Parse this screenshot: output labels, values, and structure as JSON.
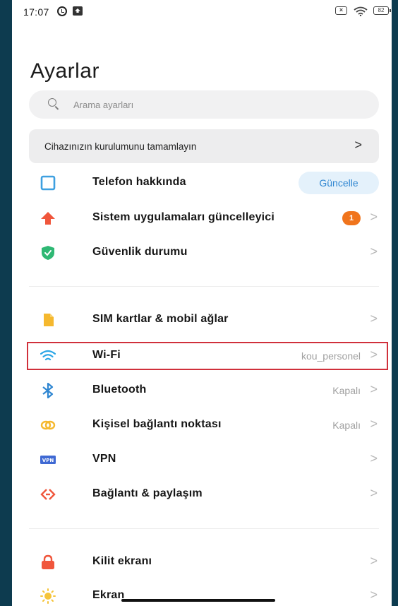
{
  "status_bar": {
    "time": "17:07",
    "alarm_icon": "alarm-clock-icon",
    "notification_icon": "upload-notification-icon",
    "sim_icon": "no-sim-icon",
    "wifi_icon": "wifi-icon",
    "battery_level": "82"
  },
  "page": {
    "title": "Ayarlar"
  },
  "search": {
    "placeholder": "Arama ayarları"
  },
  "setup_banner": {
    "text": "Cihazınızın kurulumunu tamamlayın",
    "chevron": ">"
  },
  "group1": [
    {
      "label": "Telefon hakkında",
      "action": "Güncelle",
      "icon": "phone-info-icon",
      "icon_color": "#3ea0e0"
    },
    {
      "label": "Sistem uygulamaları güncelleyici",
      "badge": "1",
      "chevron": ">",
      "icon": "arrow-up-icon",
      "icon_color": "#f0563c"
    },
    {
      "label": "Güvenlik durumu",
      "chevron": ">",
      "icon": "shield-check-icon",
      "icon_color": "#2fb874"
    }
  ],
  "group2": [
    {
      "label": "SIM kartlar & mobil ağlar",
      "chevron": ">",
      "icon": "sim-card-icon",
      "icon_color": "#f5b82e"
    },
    {
      "label": "Wi-Fi",
      "value": "kou_personel",
      "chevron": ">",
      "icon": "wifi-icon",
      "icon_color": "#2ba6e6"
    },
    {
      "label": "Bluetooth",
      "value": "Kapalı",
      "chevron": ">",
      "icon": "bluetooth-icon",
      "icon_color": "#2f86d1"
    },
    {
      "label": "Kişisel bağlantı noktası",
      "value": "Kapalı",
      "chevron": ">",
      "icon": "hotspot-icon",
      "icon_color": "#f5b82e"
    },
    {
      "label": "VPN",
      "chevron": ">",
      "icon": "vpn-icon",
      "icon_color": "#3f69d3",
      "icon_text": "VPN"
    },
    {
      "label": "Bağlantı & paylaşım",
      "chevron": ">",
      "icon": "share-icon",
      "icon_color": "#f0563c"
    }
  ],
  "group3": [
    {
      "label": "Kilit ekranı",
      "chevron": ">",
      "icon": "lock-icon",
      "icon_color": "#f0563c"
    },
    {
      "label": "Ekran",
      "chevron": ">",
      "icon": "sun-icon",
      "icon_color": "#f5c43a"
    }
  ],
  "colors": {
    "highlight_border": "#d0303b",
    "accent_blue": "#2f86d1",
    "badge_orange": "#f0741c"
  }
}
